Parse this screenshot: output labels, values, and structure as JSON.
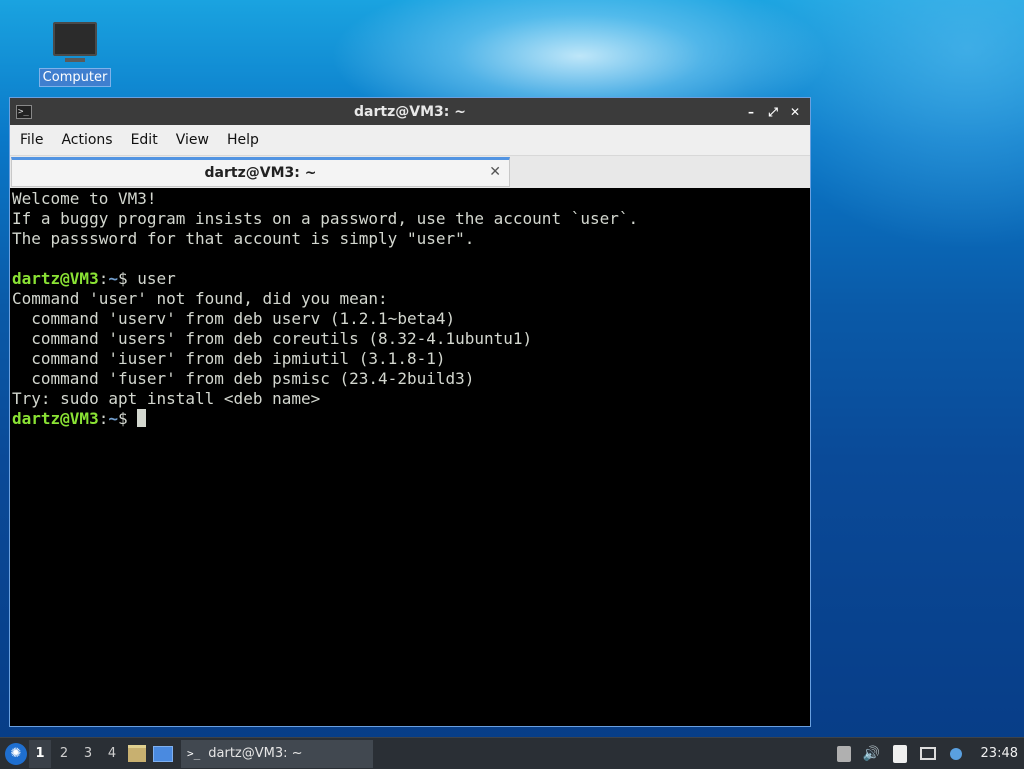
{
  "desktop": {
    "icons": [
      {
        "label": "Computer",
        "icon": "computer-icon"
      }
    ]
  },
  "window": {
    "title": "dartz@VM3: ~",
    "app_icon": "terminal-icon",
    "controls": {
      "minimize": "–",
      "maximize": "⤢",
      "close": "✕"
    },
    "menu": [
      "File",
      "Actions",
      "Edit",
      "View",
      "Help"
    ],
    "tabs": [
      {
        "label": "dartz@VM3: ~",
        "close": "✕"
      }
    ]
  },
  "terminal": {
    "lines": [
      "Welcome to VM3!",
      "If a buggy program insists on a password, use the account `user`.",
      "The passsword for that account is simply \"user\".",
      "",
      {
        "user": "dartz@VM3",
        "sep": ":",
        "path": "~",
        "symbol": "$",
        "cmd": " user"
      },
      "Command 'user' not found, did you mean:",
      "  command 'userv' from deb userv (1.2.1~beta4)",
      "  command 'users' from deb coreutils (8.32-4.1ubuntu1)",
      "  command 'iuser' from deb ipmiutil (3.1.8-1)",
      "  command 'fuser' from deb psmisc (23.4-2build3)",
      "Try: sudo apt install <deb name>",
      {
        "user": "dartz@VM3",
        "sep": ":",
        "path": "~",
        "symbol": "$",
        "cmd": " ",
        "cursor": true
      }
    ],
    "colors": {
      "background": "#000000",
      "text": "#d3d7cf",
      "prompt_user": "#8ae234",
      "prompt_path": "#729fcf"
    }
  },
  "taskbar": {
    "start_icon": "lubuntu-start-icon",
    "workspaces": [
      "1",
      "2",
      "3",
      "4"
    ],
    "active_workspace": "1",
    "launchers": [
      "file-manager-icon",
      "show-desktop-icon"
    ],
    "task": {
      "label": "dartz@VM3: ~",
      "icon": "terminal-icon"
    },
    "tray": [
      "removable-media-icon",
      "volume-icon",
      "clipboard-icon",
      "network-icon",
      "update-notifier-icon"
    ],
    "clock": "23:48"
  }
}
